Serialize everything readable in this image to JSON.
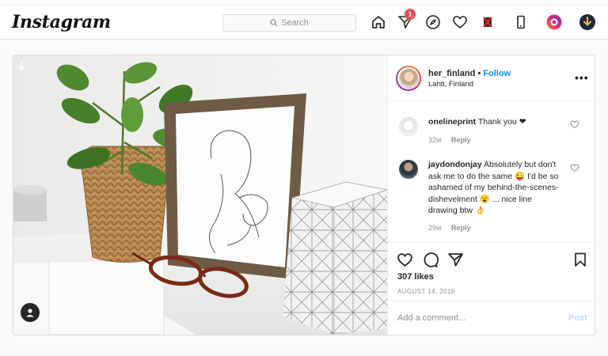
{
  "app": {
    "logo_text": "Instagram"
  },
  "search": {
    "placeholder": "Search"
  },
  "nav": {
    "icons": [
      "home-icon",
      "direct-icon",
      "explore-icon",
      "activity-heart-icon",
      "extension-icon",
      "mobile-icon",
      "profile-icon",
      "download-icon"
    ],
    "direct_badge": "1"
  },
  "post": {
    "username": "her_finland",
    "separator": "•",
    "follow_label": "Follow",
    "location": "Lahti, Finland",
    "more_label": "•••",
    "comments": [
      {
        "user": "onelineprint",
        "text": "Thank you ❤",
        "age": "32w",
        "reply_label": "Reply"
      },
      {
        "user": "jaydondonjay",
        "text": "Absolutely but don't ask me to do the same 😜 I'd be so ashamed of my behind-the-scenes-dishevelment 😮 ... nice line drawing btw 👌",
        "age": "29w",
        "reply_label": "Reply"
      }
    ],
    "likes": "307 likes",
    "date": "AUGUST 14, 2019",
    "add_comment_placeholder": "Add a comment...",
    "post_label": "Post"
  },
  "colors": {
    "accent": "#0095f6",
    "badge": "#ed4956",
    "post_disabled": "#b2dffc",
    "heart": "#c0392b"
  }
}
